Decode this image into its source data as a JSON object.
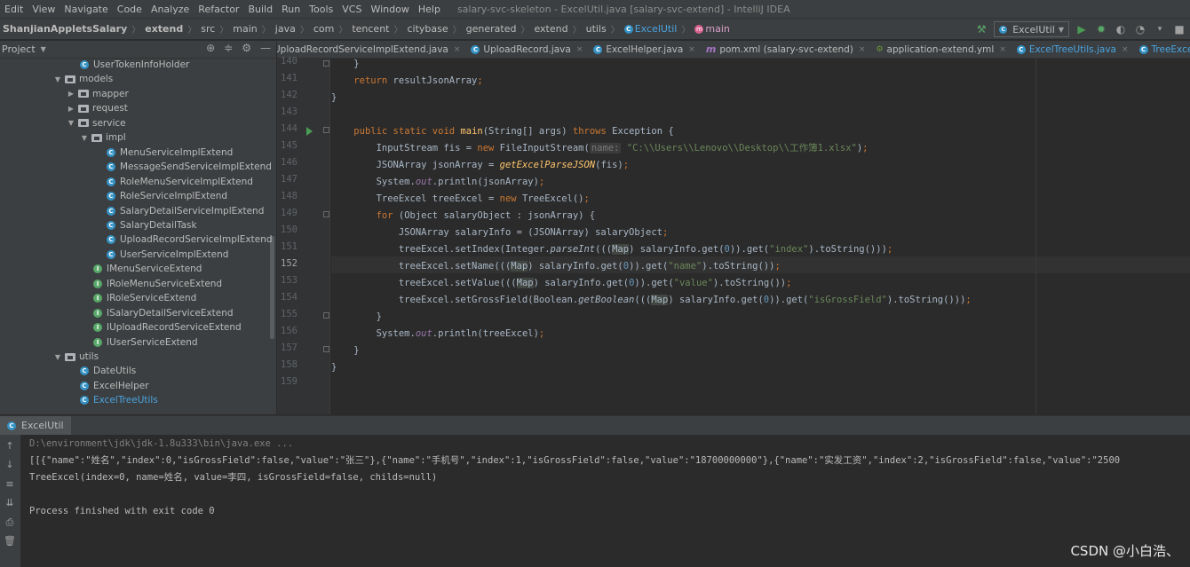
{
  "menu": {
    "items": [
      "Edit",
      "View",
      "Navigate",
      "Code",
      "Analyze",
      "Refactor",
      "Build",
      "Run",
      "Tools",
      "VCS",
      "Window",
      "Help"
    ],
    "window_title": "salary-svc-skeleton - ExcelUtil.java [salary-svc-extend] - IntelliJ IDEA"
  },
  "breadcrumb": {
    "items": [
      "ShanjianAppletsSalary",
      "extend",
      "src",
      "main",
      "java",
      "com",
      "tencent",
      "citybase",
      "generated",
      "extend",
      "utils"
    ],
    "class_name": "ExcelUtil",
    "method_name": "main"
  },
  "run_config": {
    "label": "ExcelUtil"
  },
  "project_panel": {
    "title": "Project"
  },
  "tree": [
    {
      "label": "UserTokenInfoHolder",
      "type": "class",
      "indent": 6,
      "arrow": ""
    },
    {
      "label": "models",
      "type": "folder",
      "indent": 4,
      "arrow": "▼"
    },
    {
      "label": "mapper",
      "type": "folder",
      "indent": 5,
      "arrow": "▶"
    },
    {
      "label": "request",
      "type": "folder",
      "indent": 5,
      "arrow": "▶"
    },
    {
      "label": "service",
      "type": "folder",
      "indent": 5,
      "arrow": "▼"
    },
    {
      "label": "impl",
      "type": "folder",
      "indent": 6,
      "arrow": "▼"
    },
    {
      "label": "MenuServiceImplExtend",
      "type": "class",
      "indent": 8,
      "arrow": ""
    },
    {
      "label": "MessageSendServiceImplExtend",
      "type": "class",
      "indent": 8,
      "arrow": ""
    },
    {
      "label": "RoleMenuServiceImplExtend",
      "type": "class",
      "indent": 8,
      "arrow": ""
    },
    {
      "label": "RoleServiceImplExtend",
      "type": "class",
      "indent": 8,
      "arrow": ""
    },
    {
      "label": "SalaryDetailServiceImplExtend",
      "type": "class",
      "indent": 8,
      "arrow": ""
    },
    {
      "label": "SalaryDetailTask",
      "type": "class",
      "indent": 8,
      "arrow": ""
    },
    {
      "label": "UploadRecordServiceImplExtend",
      "type": "class",
      "indent": 8,
      "arrow": ""
    },
    {
      "label": "UserServiceImplExtend",
      "type": "class",
      "indent": 8,
      "arrow": ""
    },
    {
      "label": "IMenuServiceExtend",
      "type": "interface",
      "indent": 7,
      "arrow": ""
    },
    {
      "label": "IRoleMenuServiceExtend",
      "type": "interface",
      "indent": 7,
      "arrow": ""
    },
    {
      "label": "IRoleServiceExtend",
      "type": "interface",
      "indent": 7,
      "arrow": ""
    },
    {
      "label": "ISalaryDetailServiceExtend",
      "type": "interface",
      "indent": 7,
      "arrow": ""
    },
    {
      "label": "IUploadRecordServiceExtend",
      "type": "interface",
      "indent": 7,
      "arrow": ""
    },
    {
      "label": "IUserServiceExtend",
      "type": "interface",
      "indent": 7,
      "arrow": ""
    },
    {
      "label": "utils",
      "type": "folder",
      "indent": 4,
      "arrow": "▼"
    },
    {
      "label": "DateUtils",
      "type": "class",
      "indent": 6,
      "arrow": ""
    },
    {
      "label": "ExcelHelper",
      "type": "class",
      "indent": 6,
      "arrow": ""
    },
    {
      "label": "ExcelTreeUtils",
      "type": "class",
      "indent": 6,
      "arrow": ""
    }
  ],
  "tabs": [
    {
      "label": "UploadRecordServiceImplExtend.java",
      "icon": "class-icon"
    },
    {
      "label": "UploadRecord.java",
      "icon": "class-icon"
    },
    {
      "label": "ExcelHelper.java",
      "icon": "class-icon"
    },
    {
      "label": "pom.xml (salary-svc-extend)",
      "icon": "maven-icon"
    },
    {
      "label": "application-extend.yml",
      "icon": "yaml-icon"
    },
    {
      "label": "ExcelTreeUtils.java",
      "icon": "class-icon"
    },
    {
      "label": "TreeExcel.java",
      "icon": "class-icon"
    }
  ],
  "editor": {
    "line_numbers": [
      "140",
      "141",
      "142",
      "143",
      "144",
      "145",
      "146",
      "147",
      "148",
      "149",
      "150",
      "151",
      "152",
      "153",
      "154",
      "155",
      "156",
      "157",
      "158",
      "159"
    ],
    "current_line": "152",
    "path_hint": "C:\\\\Users\\\\Lenovo\\\\Desktop\\\\工作簿1.xlsx",
    "hint_label": "name:"
  },
  "run_panel": {
    "tab_label": "ExcelUtil",
    "lines": [
      "D:\\environment\\jdk\\jdk-1.8u333\\bin\\java.exe ...",
      "[[{\"name\":\"姓名\",\"index\":0,\"isGrossField\":false,\"value\":\"张三\"},{\"name\":\"手机号\",\"index\":1,\"isGrossField\":false,\"value\":\"18700000000\"},{\"name\":\"实发工资\",\"index\":2,\"isGrossField\":false,\"value\":\"2500",
      "TreeExcel(index=0, name=姓名, value=李四, isGrossField=false, childs=null)",
      "",
      "Process finished with exit code 0"
    ]
  },
  "watermark": "CSDN @小白浩、"
}
